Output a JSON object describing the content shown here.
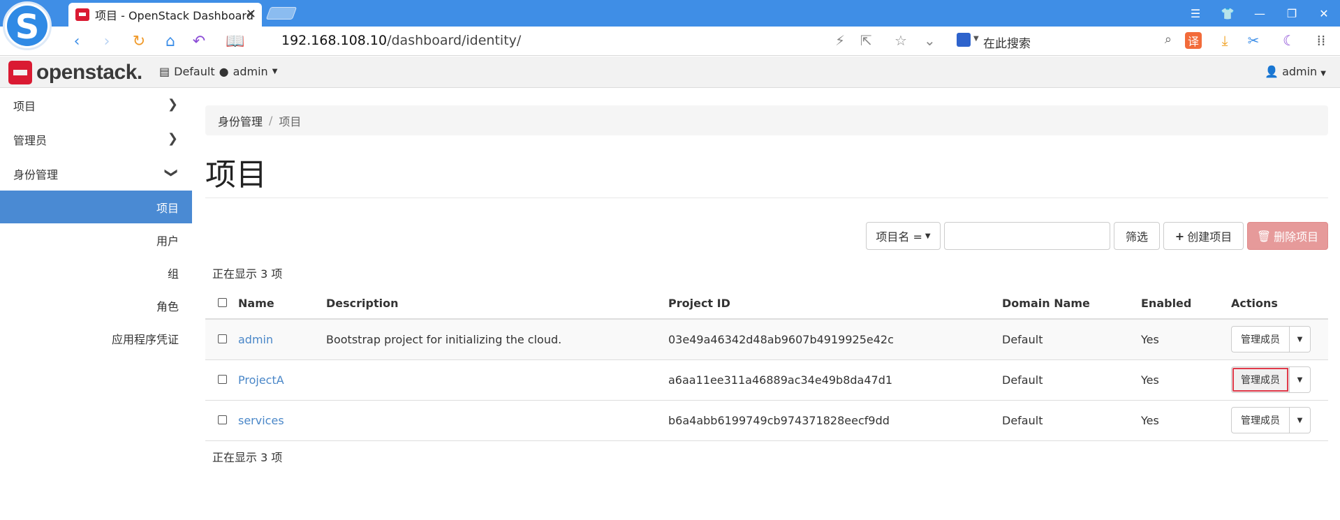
{
  "browser": {
    "tab_title": "项目 - OpenStack Dashboard",
    "url_host": "192.168.108.10",
    "url_path": "/dashboard/identity/",
    "search_placeholder": "在此搜索",
    "translate_label": "译"
  },
  "header": {
    "logo_text": "openstack.",
    "domain_label": "Default",
    "project_label": "admin",
    "user_label": "admin"
  },
  "sidebar": {
    "categories": [
      {
        "label": "项目",
        "chevron": "›"
      },
      {
        "label": "管理员",
        "chevron": "›"
      },
      {
        "label": "身份管理",
        "chevron": "⌄"
      }
    ],
    "items": [
      {
        "label": "项目",
        "active": true
      },
      {
        "label": "用户"
      },
      {
        "label": "组"
      },
      {
        "label": "角色"
      },
      {
        "label": "应用程序凭证"
      }
    ]
  },
  "breadcrumb": {
    "parent": "身份管理",
    "sep": "/",
    "current": "项目"
  },
  "page_title": "项目",
  "toolbar": {
    "filter_field_label": "项目名 =",
    "filter_value": "",
    "filter_button": "筛选",
    "create_button": "创建项目",
    "delete_button": "删除项目"
  },
  "table": {
    "count_top": "正在显示 3 项",
    "count_bottom": "正在显示 3 项",
    "headers": {
      "name": "Name",
      "description": "Description",
      "project_id": "Project ID",
      "domain": "Domain Name",
      "enabled": "Enabled",
      "actions": "Actions"
    },
    "rows": [
      {
        "name": "admin",
        "description": "Bootstrap project for initializing the cloud.",
        "project_id": "03e49a46342d48ab9607b4919925e42c",
        "domain": "Default",
        "enabled": "Yes",
        "action": "管理成员"
      },
      {
        "name": "ProjectA",
        "description": "",
        "project_id": "a6aa11ee311a46889ac34e49b8da47d1",
        "domain": "Default",
        "enabled": "Yes",
        "action": "管理成员"
      },
      {
        "name": "services",
        "description": "",
        "project_id": "b6a4abb6199749cb974371828eecf9dd",
        "domain": "Default",
        "enabled": "Yes",
        "action": "管理成员"
      }
    ]
  },
  "colors": {
    "browser_blue": "#3f8ee6",
    "sidebar_active": "#4a8ad3",
    "link": "#4a87c8",
    "danger": "#e69a9a",
    "brand_red": "#da1a32"
  }
}
